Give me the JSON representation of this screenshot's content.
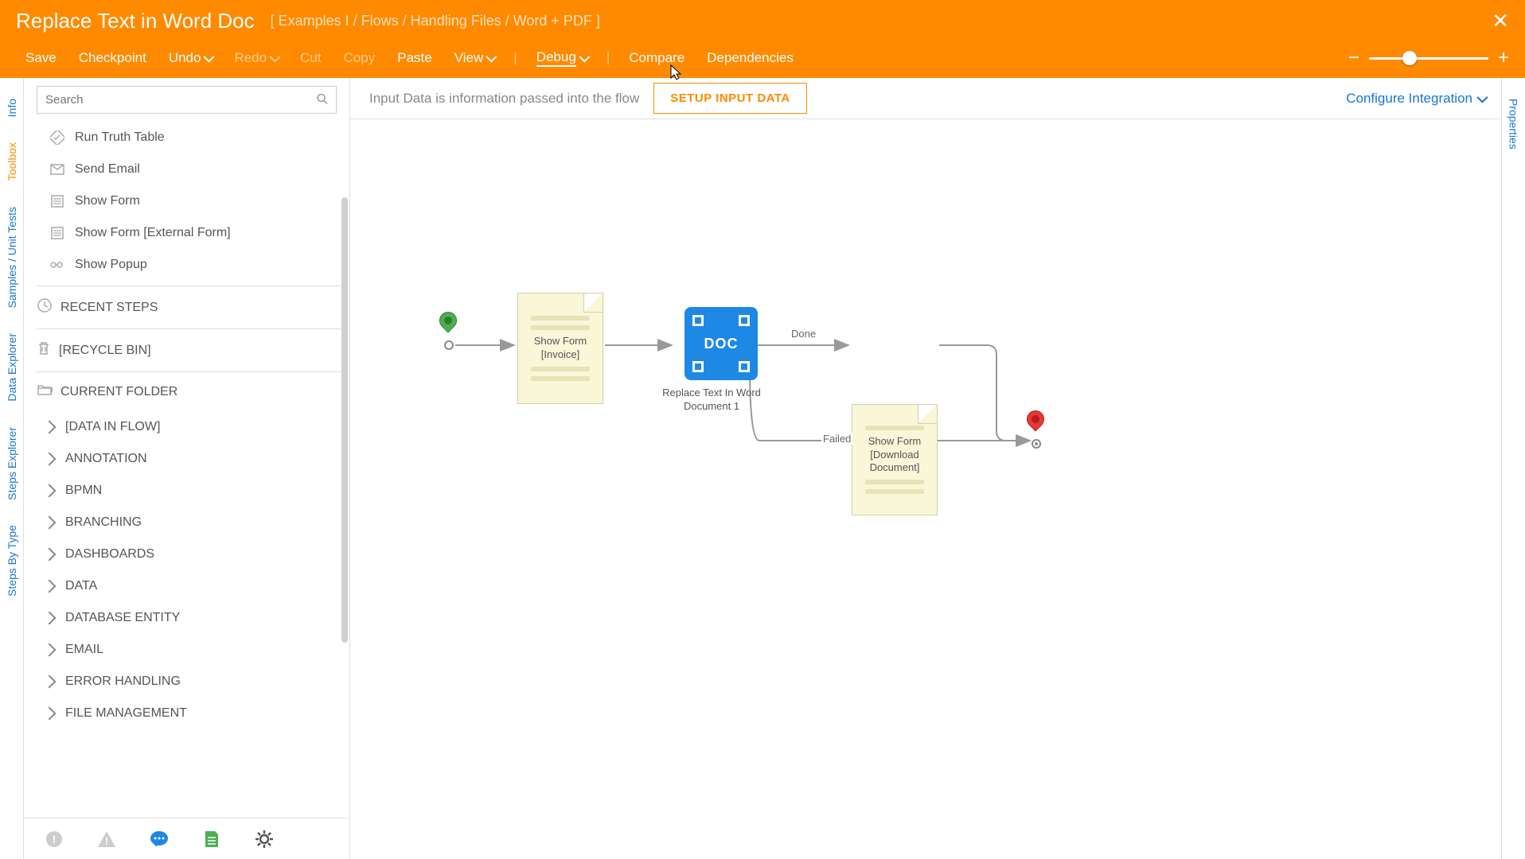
{
  "header": {
    "title": "Replace Text in Word Doc",
    "breadcrumb": "[ Examples I / Flows / Handling Files / Word + PDF ]"
  },
  "menu": {
    "save": "Save",
    "checkpoint": "Checkpoint",
    "undo": "Undo",
    "redo": "Redo",
    "cut": "Cut",
    "copy": "Copy",
    "paste": "Paste",
    "view": "View",
    "debug": "Debug",
    "compare": "Compare",
    "dependencies": "Dependencies"
  },
  "subheader": {
    "hint": "Input Data is information passed into the flow",
    "setup_btn": "SETUP INPUT DATA",
    "configure": "Configure Integration"
  },
  "left_tabs": {
    "info": "Info",
    "toolbox": "Toolbox",
    "samples": "Samples / Unit Tests",
    "data_explorer": "Data Explorer",
    "steps_explorer": "Steps Explorer",
    "steps_by_type": "Steps By Type"
  },
  "right_tabs": {
    "properties": "Properties"
  },
  "search": {
    "placeholder": "Search"
  },
  "favorites": [
    "Run Truth Table",
    "Send Email",
    "Show Form",
    "Show Form [External Form]",
    "Show Popup"
  ],
  "sections": {
    "recent": "RECENT STEPS",
    "recycle": "[RECYCLE BIN]",
    "current": "CURRENT FOLDER"
  },
  "folders": [
    "[DATA IN FLOW]",
    "ANNOTATION",
    "BPMN",
    "BRANCHING",
    "DASHBOARDS",
    "DATA",
    "DATABASE ENTITY",
    "EMAIL",
    "ERROR HANDLING",
    "FILE MANAGEMENT"
  ],
  "flow": {
    "show_form_1": "Show Form\n[Invoice]",
    "replace_step": "Replace Text In Word Document 1",
    "doc_badge": "DOC",
    "show_form_2": "Show Form\n[Download Document]",
    "done": "Done",
    "failed": "Failed"
  }
}
